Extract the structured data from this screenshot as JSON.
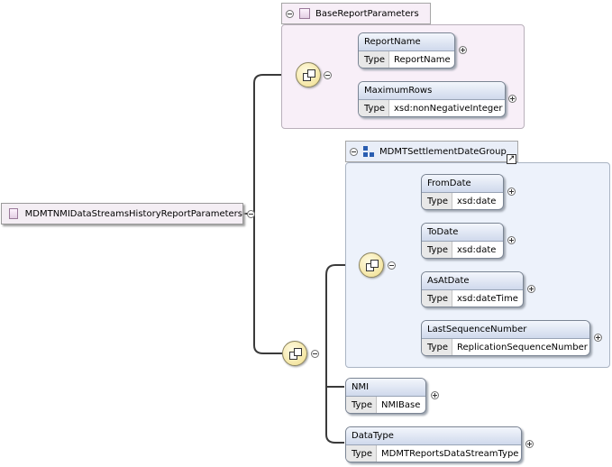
{
  "root": {
    "name": "MDMTNMIDataStreamsHistoryReportParameters",
    "icon": "complex-type-icon"
  },
  "base_group": {
    "title": "BaseReportParameters",
    "icon": "complex-type-icon",
    "elements": [
      {
        "name": "ReportName",
        "type_label": "Type",
        "type": "ReportName"
      },
      {
        "name": "MaximumRows",
        "type_label": "Type",
        "type": "xsd:nonNegativeInteger"
      }
    ]
  },
  "settlement_group": {
    "title": "MDMTSettlementDateGroup",
    "icon": "group-icon",
    "elements": [
      {
        "name": "FromDate",
        "type_label": "Type",
        "type": "xsd:date"
      },
      {
        "name": "ToDate",
        "type_label": "Type",
        "type": "xsd:date"
      },
      {
        "name": "AsAtDate",
        "type_label": "Type",
        "type": "xsd:dateTime"
      },
      {
        "name": "LastSequenceNumber",
        "type_label": "Type",
        "type": "ReplicationSequenceNumber"
      }
    ]
  },
  "nmi": {
    "name": "NMI",
    "type_label": "Type",
    "type": "NMIBase"
  },
  "datatype": {
    "name": "DataType",
    "type_label": "Type",
    "type": "MDMTReportsDataStreamType"
  },
  "colors": {
    "pink_box": "#f8eff8",
    "blue_box": "#edf2fb",
    "element_header": "#cfd9ec",
    "compositor": "#f0dd8a"
  }
}
